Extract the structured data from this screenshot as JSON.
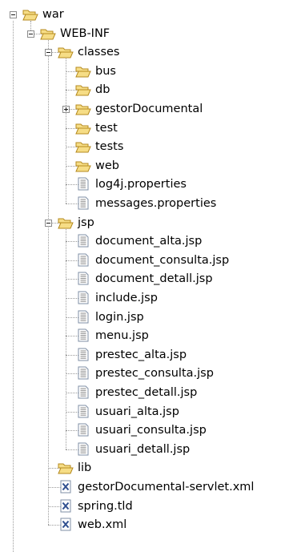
{
  "tree": [
    {
      "label": "war",
      "type": "folder",
      "depth": 0,
      "toggle": "expanded",
      "icon": "folder-open-icon"
    },
    {
      "label": "WEB-INF",
      "type": "folder",
      "depth": 1,
      "toggle": "expanded",
      "icon": "folder-open-icon"
    },
    {
      "label": "classes",
      "type": "folder",
      "depth": 2,
      "toggle": "expanded",
      "icon": "folder-open-icon"
    },
    {
      "label": "bus",
      "type": "folder",
      "depth": 3,
      "toggle": "none",
      "icon": "folder-open-icon"
    },
    {
      "label": "db",
      "type": "folder",
      "depth": 3,
      "toggle": "none",
      "icon": "folder-open-icon"
    },
    {
      "label": "gestorDocumental",
      "type": "folder",
      "depth": 3,
      "toggle": "collapsed",
      "icon": "folder-open-icon"
    },
    {
      "label": "test",
      "type": "folder",
      "depth": 3,
      "toggle": "none",
      "icon": "folder-open-icon"
    },
    {
      "label": "tests",
      "type": "folder",
      "depth": 3,
      "toggle": "none",
      "icon": "folder-open-icon"
    },
    {
      "label": "web",
      "type": "folder",
      "depth": 3,
      "toggle": "none",
      "icon": "folder-open-icon"
    },
    {
      "label": "log4j.properties",
      "type": "file",
      "depth": 3,
      "toggle": "none",
      "icon": "text-file-icon"
    },
    {
      "label": "messages.properties",
      "type": "file",
      "depth": 3,
      "toggle": "none",
      "icon": "text-file-icon"
    },
    {
      "label": "jsp",
      "type": "folder",
      "depth": 2,
      "toggle": "expanded",
      "icon": "folder-open-icon"
    },
    {
      "label": "document_alta.jsp",
      "type": "file",
      "depth": 3,
      "toggle": "none",
      "icon": "jsp-file-icon"
    },
    {
      "label": "document_consulta.jsp",
      "type": "file",
      "depth": 3,
      "toggle": "none",
      "icon": "jsp-file-icon"
    },
    {
      "label": "document_detall.jsp",
      "type": "file",
      "depth": 3,
      "toggle": "none",
      "icon": "jsp-file-icon"
    },
    {
      "label": "include.jsp",
      "type": "file",
      "depth": 3,
      "toggle": "none",
      "icon": "jsp-file-icon"
    },
    {
      "label": "login.jsp",
      "type": "file",
      "depth": 3,
      "toggle": "none",
      "icon": "jsp-file-icon"
    },
    {
      "label": "menu.jsp",
      "type": "file",
      "depth": 3,
      "toggle": "none",
      "icon": "jsp-file-icon"
    },
    {
      "label": "prestec_alta.jsp",
      "type": "file",
      "depth": 3,
      "toggle": "none",
      "icon": "jsp-file-icon"
    },
    {
      "label": "prestec_consulta.jsp",
      "type": "file",
      "depth": 3,
      "toggle": "none",
      "icon": "jsp-file-icon"
    },
    {
      "label": "prestec_detall.jsp",
      "type": "file",
      "depth": 3,
      "toggle": "none",
      "icon": "jsp-file-icon"
    },
    {
      "label": "usuari_alta.jsp",
      "type": "file",
      "depth": 3,
      "toggle": "none",
      "icon": "jsp-file-icon"
    },
    {
      "label": "usuari_consulta.jsp",
      "type": "file",
      "depth": 3,
      "toggle": "none",
      "icon": "jsp-file-icon"
    },
    {
      "label": "usuari_detall.jsp",
      "type": "file",
      "depth": 3,
      "toggle": "none",
      "icon": "jsp-file-icon"
    },
    {
      "label": "lib",
      "type": "folder",
      "depth": 2,
      "toggle": "none",
      "icon": "folder-open-icon"
    },
    {
      "label": "gestorDocumental-servlet.xml",
      "type": "file",
      "depth": 2,
      "toggle": "none",
      "icon": "xml-file-icon"
    },
    {
      "label": "spring.tld",
      "type": "file",
      "depth": 2,
      "toggle": "none",
      "icon": "xml-file-icon"
    },
    {
      "label": "web.xml",
      "type": "file",
      "depth": 2,
      "toggle": "none",
      "icon": "xml-file-icon"
    }
  ],
  "colors": {
    "folder_fill": "#f6dd86",
    "folder_stroke": "#b58a1f",
    "file_stroke": "#7f8fa6",
    "xml_mark": "#2f4f8f",
    "guide_line": "#9a9a9a"
  }
}
